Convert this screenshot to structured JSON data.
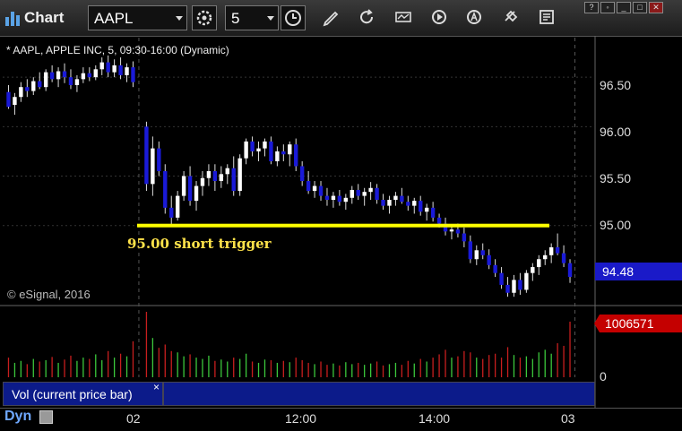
{
  "titlebar": {
    "app_title": "Chart",
    "symbol": "AAPL",
    "interval": "5"
  },
  "chart_header": "* AAPL, APPLE INC, 5, 09:30-16:00 (Dynamic)",
  "copyright": "© eSignal, 2016",
  "annotation": "95.00 short trigger",
  "price_axis": {
    "labels": [
      "96.50",
      "96.00",
      "95.50",
      "95.00"
    ],
    "current_price": "94.48"
  },
  "volume_panel": {
    "label": "Vol (current price bar)",
    "close_glyph": "×",
    "current_volume": "1006571",
    "zero_label": "0"
  },
  "time_axis": {
    "labels": [
      "02",
      "12:00",
      "14:00",
      "03"
    ]
  },
  "footer": {
    "mode": "Dyn"
  },
  "colors": {
    "up_candle": "#ffffff",
    "down_candle": "#1a1ad8",
    "trigger_line": "#ffff00",
    "vol_up": "#3cc83c",
    "vol_down": "#c81e1e",
    "price_flag": "#1a1ac8",
    "volume_flag": "#c40000"
  },
  "chart_data": {
    "type": "candlestick",
    "symbol": "AAPL",
    "timeframe": "5",
    "ylim": [
      94.2,
      96.9
    ],
    "trigger_level": 95.0,
    "last_price": 94.48,
    "last_volume": 1006571,
    "sessions": [
      {
        "name": "prior",
        "candles": [
          [
            96.35,
            96.42,
            96.18,
            96.2
          ],
          [
            96.22,
            96.34,
            96.12,
            96.3
          ],
          [
            96.3,
            96.45,
            96.25,
            96.4
          ],
          [
            96.4,
            96.48,
            96.3,
            96.36
          ],
          [
            96.36,
            96.5,
            96.32,
            96.46
          ],
          [
            96.46,
            96.55,
            96.38,
            96.4
          ],
          [
            96.4,
            96.58,
            96.36,
            96.55
          ],
          [
            96.55,
            96.62,
            96.45,
            96.48
          ],
          [
            96.48,
            96.6,
            96.4,
            96.56
          ],
          [
            96.56,
            96.64,
            96.44,
            96.5
          ],
          [
            96.5,
            96.58,
            96.38,
            96.42
          ],
          [
            96.42,
            96.52,
            96.35,
            96.48
          ],
          [
            96.48,
            96.6,
            96.44,
            96.54
          ],
          [
            96.54,
            96.6,
            96.46,
            96.5
          ],
          [
            96.5,
            96.62,
            96.47,
            96.58
          ],
          [
            96.58,
            96.7,
            96.52,
            96.65
          ],
          [
            96.65,
            96.72,
            96.5,
            96.55
          ],
          [
            96.55,
            96.68,
            96.5,
            96.62
          ],
          [
            96.62,
            96.7,
            96.48,
            96.52
          ],
          [
            96.52,
            96.64,
            96.45,
            96.6
          ],
          [
            96.6,
            96.66,
            96.4,
            96.45
          ]
        ],
        "volumes": [
          0.3,
          0.22,
          0.25,
          0.2,
          0.28,
          0.24,
          0.26,
          0.31,
          0.22,
          0.27,
          0.33,
          0.25,
          0.3,
          0.28,
          0.35,
          0.26,
          0.4,
          0.3,
          0.36,
          0.32,
          0.55
        ]
      },
      {
        "name": "current",
        "candles": [
          [
            96.0,
            96.05,
            95.35,
            95.42
          ],
          [
            95.42,
            95.9,
            95.3,
            95.78
          ],
          [
            95.78,
            95.85,
            95.5,
            95.55
          ],
          [
            95.55,
            95.62,
            95.12,
            95.18
          ],
          [
            95.18,
            95.3,
            95.0,
            95.08
          ],
          [
            95.08,
            95.35,
            95.05,
            95.3
          ],
          [
            95.3,
            95.55,
            95.25,
            95.5
          ],
          [
            95.5,
            95.6,
            95.2,
            95.25
          ],
          [
            95.25,
            95.45,
            95.15,
            95.4
          ],
          [
            95.4,
            95.55,
            95.3,
            95.48
          ],
          [
            95.48,
            95.62,
            95.4,
            95.55
          ],
          [
            95.55,
            95.62,
            95.35,
            95.45
          ],
          [
            95.45,
            95.6,
            95.38,
            95.52
          ],
          [
            95.52,
            95.62,
            95.42,
            95.58
          ],
          [
            95.58,
            95.7,
            95.3,
            95.35
          ],
          [
            95.35,
            95.72,
            95.3,
            95.68
          ],
          [
            95.68,
            95.88,
            95.62,
            95.85
          ],
          [
            95.85,
            95.9,
            95.7,
            95.75
          ],
          [
            95.75,
            95.85,
            95.65,
            95.78
          ],
          [
            95.78,
            95.88,
            95.7,
            95.85
          ],
          [
            95.85,
            95.9,
            95.62,
            95.65
          ],
          [
            95.65,
            95.8,
            95.6,
            95.75
          ],
          [
            95.75,
            95.82,
            95.65,
            95.72
          ],
          [
            95.72,
            95.85,
            95.6,
            95.82
          ],
          [
            95.82,
            95.88,
            95.55,
            95.6
          ],
          [
            95.6,
            95.65,
            95.4,
            95.45
          ],
          [
            95.45,
            95.55,
            95.32,
            95.35
          ],
          [
            95.35,
            95.45,
            95.28,
            95.4
          ],
          [
            95.4,
            95.45,
            95.25,
            95.3
          ],
          [
            95.3,
            95.38,
            95.2,
            95.26
          ],
          [
            95.26,
            95.34,
            95.18,
            95.3
          ],
          [
            95.3,
            95.36,
            95.2,
            95.24
          ],
          [
            95.24,
            95.32,
            95.16,
            95.28
          ],
          [
            95.28,
            95.4,
            95.22,
            95.36
          ],
          [
            95.36,
            95.42,
            95.26,
            95.3
          ],
          [
            95.3,
            95.38,
            95.2,
            95.34
          ],
          [
            95.34,
            95.44,
            95.26,
            95.38
          ],
          [
            95.38,
            95.42,
            95.22,
            95.26
          ],
          [
            95.26,
            95.32,
            95.16,
            95.2
          ],
          [
            95.2,
            95.3,
            95.12,
            95.26
          ],
          [
            95.26,
            95.34,
            95.2,
            95.3
          ],
          [
            95.3,
            95.38,
            95.22,
            95.24
          ],
          [
            95.24,
            95.3,
            95.15,
            95.2
          ],
          [
            95.2,
            95.28,
            95.12,
            95.25
          ],
          [
            95.25,
            95.3,
            95.1,
            95.14
          ],
          [
            95.14,
            95.22,
            95.05,
            95.18
          ],
          [
            95.18,
            95.24,
            95.04,
            95.08
          ],
          [
            95.08,
            95.12,
            94.98,
            95.02
          ],
          [
            95.02,
            95.08,
            94.9,
            94.94
          ],
          [
            94.94,
            95.0,
            94.86,
            94.96
          ],
          [
            94.96,
            95.02,
            94.88,
            94.92
          ],
          [
            94.92,
            94.98,
            94.78,
            94.84
          ],
          [
            94.84,
            94.9,
            94.62,
            94.66
          ],
          [
            94.66,
            94.8,
            94.6,
            94.75
          ],
          [
            94.75,
            94.82,
            94.66,
            94.7
          ],
          [
            94.7,
            94.76,
            94.56,
            94.6
          ],
          [
            94.6,
            94.66,
            94.48,
            94.52
          ],
          [
            94.52,
            94.58,
            94.36,
            94.4
          ],
          [
            94.4,
            94.48,
            94.28,
            94.32
          ],
          [
            94.32,
            94.5,
            94.28,
            94.45
          ],
          [
            94.45,
            94.52,
            94.3,
            94.35
          ],
          [
            94.35,
            94.55,
            94.32,
            94.52
          ],
          [
            94.52,
            94.62,
            94.44,
            94.58
          ],
          [
            94.58,
            94.7,
            94.5,
            94.66
          ],
          [
            94.66,
            94.75,
            94.6,
            94.7
          ],
          [
            94.7,
            94.82,
            94.62,
            94.78
          ],
          [
            94.78,
            94.92,
            94.7,
            94.72
          ],
          [
            94.72,
            94.8,
            94.58,
            94.62
          ],
          [
            94.62,
            94.66,
            94.42,
            94.48
          ]
        ],
        "volumes": [
          1.0,
          0.6,
          0.45,
          0.5,
          0.4,
          0.38,
          0.32,
          0.35,
          0.3,
          0.28,
          0.33,
          0.25,
          0.27,
          0.24,
          0.3,
          0.28,
          0.36,
          0.24,
          0.22,
          0.27,
          0.26,
          0.22,
          0.25,
          0.23,
          0.3,
          0.26,
          0.22,
          0.2,
          0.24,
          0.19,
          0.21,
          0.18,
          0.23,
          0.2,
          0.22,
          0.19,
          0.21,
          0.24,
          0.18,
          0.2,
          0.22,
          0.19,
          0.25,
          0.21,
          0.28,
          0.24,
          0.3,
          0.35,
          0.42,
          0.3,
          0.32,
          0.4,
          0.38,
          0.3,
          0.28,
          0.34,
          0.36,
          0.3,
          0.46,
          0.34,
          0.3,
          0.32,
          0.28,
          0.38,
          0.42,
          0.36,
          0.52,
          0.48,
          0.85
        ]
      }
    ]
  }
}
